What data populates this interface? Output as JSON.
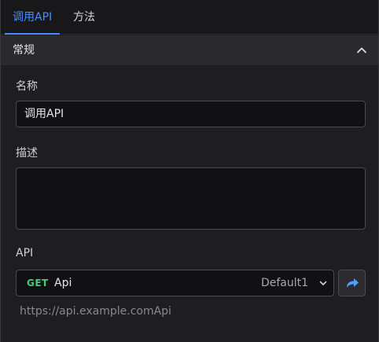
{
  "tabs": [
    {
      "label": "调用API",
      "active": true
    },
    {
      "label": "方法",
      "active": false
    }
  ],
  "section": {
    "title": "常规",
    "expanded": true
  },
  "fields": {
    "name_label": "名称",
    "name_value": "调用API",
    "description_label": "描述",
    "description_value": "",
    "api_label": "API"
  },
  "api": {
    "method": "GET",
    "name": "Api",
    "environment": "Default1",
    "url": "https://api.example.comApi"
  },
  "icons": {
    "collapse": "chevron-up-icon",
    "dropdown": "chevron-down-icon",
    "goto": "share-arrow-icon"
  },
  "colors": {
    "accent": "#4a8cff",
    "method_get": "#3fcf7a",
    "goto_icon": "#4aa3ff"
  }
}
